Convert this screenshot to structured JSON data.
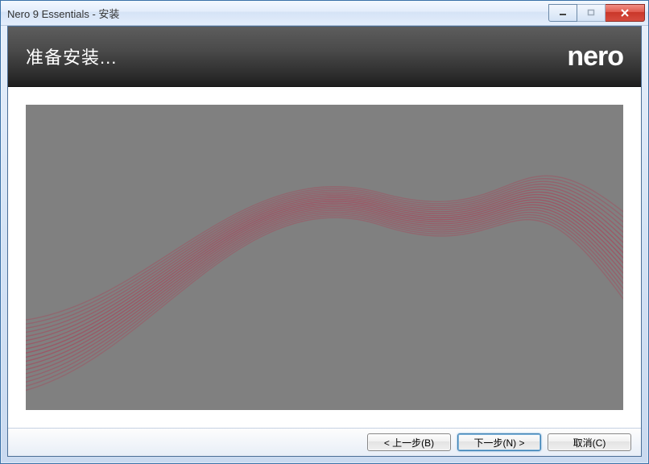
{
  "window": {
    "title": "Nero 9 Essentials - 安装"
  },
  "header": {
    "heading": "准备安装...",
    "logo": "nero"
  },
  "footer": {
    "back": "< 上一步(B)",
    "next": "下一步(N) >",
    "cancel": "取消(C)"
  }
}
